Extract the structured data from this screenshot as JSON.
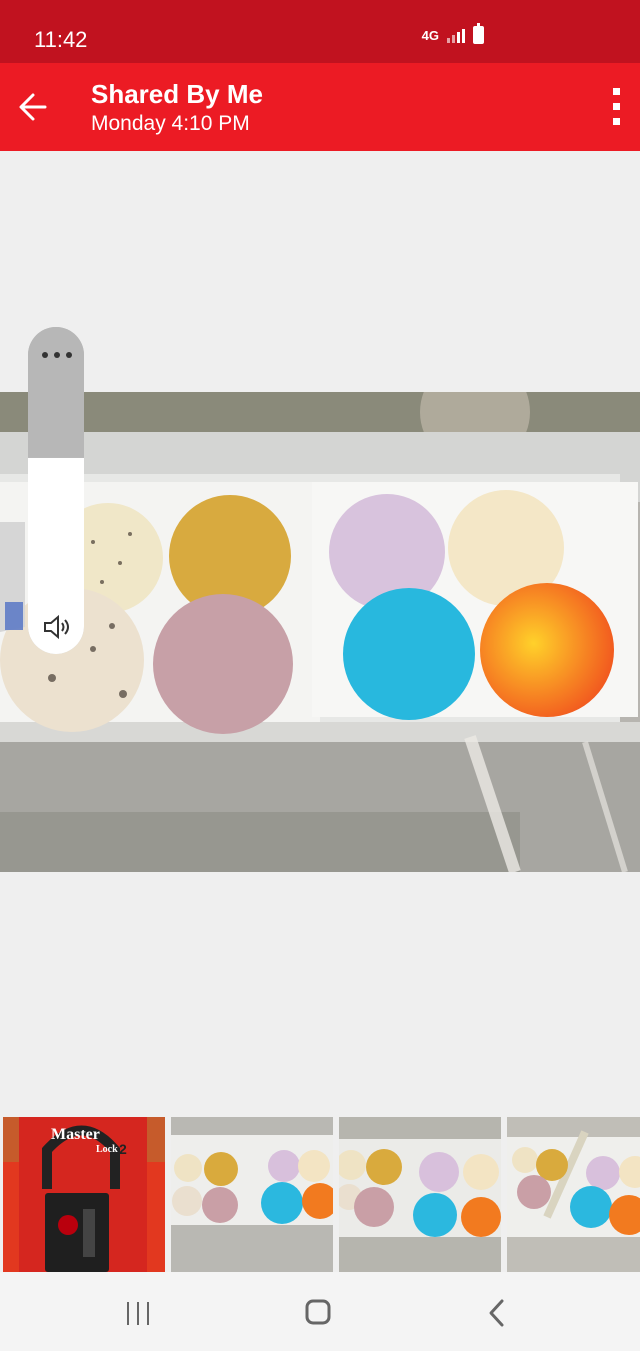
{
  "status": {
    "time": "11:42",
    "network": "4G",
    "icons": [
      "network-4g-icon",
      "signal-icon",
      "battery-icon"
    ]
  },
  "header": {
    "title": "Shared By Me",
    "subtitle": "Monday 4:10 PM",
    "back_icon": "back-arrow-icon",
    "more_icon": "more-vertical-icon",
    "colors": {
      "status": "#c1121f",
      "bar": "#ec1b24"
    }
  },
  "volume_panel": {
    "level": 0.6,
    "menu_icon": "more-horizontal-icon",
    "speaker_icon": "speaker-icon"
  },
  "photo": {
    "subject": "ice-cream-freezer-photo"
  },
  "thumbnails": [
    {
      "name": "thumb-lock-photo",
      "text_logo": "Master Lock",
      "lock_number": "2"
    },
    {
      "name": "thumb-freezer-photo-1"
    },
    {
      "name": "thumb-freezer-photo-2"
    },
    {
      "name": "thumb-freezer-photo-3"
    }
  ],
  "nav": {
    "recents_icon": "recents-icon",
    "home_icon": "home-icon",
    "back_icon": "nav-back-icon"
  }
}
